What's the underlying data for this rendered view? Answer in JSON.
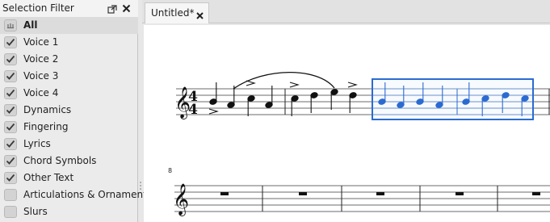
{
  "panel": {
    "title": "Selection Filter",
    "float_icon": "float-window-icon",
    "close_icon": "close-icon",
    "items": [
      {
        "label": "All",
        "checked": "partial"
      },
      {
        "label": "Voice 1",
        "checked": true
      },
      {
        "label": "Voice 2",
        "checked": true
      },
      {
        "label": "Voice 3",
        "checked": true
      },
      {
        "label": "Voice 4",
        "checked": true
      },
      {
        "label": "Dynamics",
        "checked": true
      },
      {
        "label": "Fingering",
        "checked": true
      },
      {
        "label": "Lyrics",
        "checked": true
      },
      {
        "label": "Chord Symbols",
        "checked": true
      },
      {
        "label": "Other Text",
        "checked": true
      },
      {
        "label": "Articulations & Ornaments",
        "checked": false
      },
      {
        "label": "Slurs",
        "checked": false
      }
    ]
  },
  "tabs": [
    {
      "label": "Untitled*",
      "close_icon": "close-icon"
    }
  ],
  "score": {
    "time_signature_top": "4",
    "time_signature_bottom": "4",
    "second_system_measure_number": "8",
    "selection_color": "#2b6bd1",
    "note_color": "#111111"
  }
}
